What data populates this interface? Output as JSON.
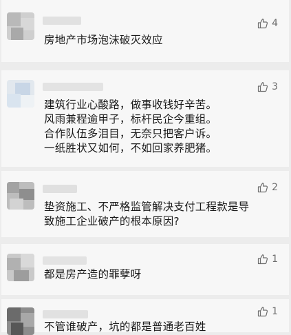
{
  "colors": {
    "page_background": "#ececec",
    "card_background": "#f7f7f7",
    "text": "#1a1a1a",
    "like_gray": "#6d6d6d"
  },
  "comments": [
    {
      "text": "房地产市场泡沫破灭效应",
      "likes": "4",
      "like_icon": "thumbs-up-icon"
    },
    {
      "text": "建筑行业心酸路，做事收钱好辛苦。\n风雨兼程逾甲子，标杆民企今重组。\n合作队伍多泪目，无奈只把客户诉。\n一纸胜状又如何，不如回家养肥猪。",
      "likes": "3",
      "like_icon": "thumbs-up-icon"
    },
    {
      "text": "垫资施工、不严格监管解决支付工程款是导\n致施工企业破产的根本原因?",
      "likes": "2",
      "like_icon": "thumbs-up-icon"
    },
    {
      "text": "都是房产造的罪孽呀",
      "likes": "1",
      "like_icon": "thumbs-up-icon"
    },
    {
      "text": "不管谁破产，坑的都是普通老百姓",
      "likes": "1",
      "like_icon": "thumbs-up-icon"
    }
  ]
}
